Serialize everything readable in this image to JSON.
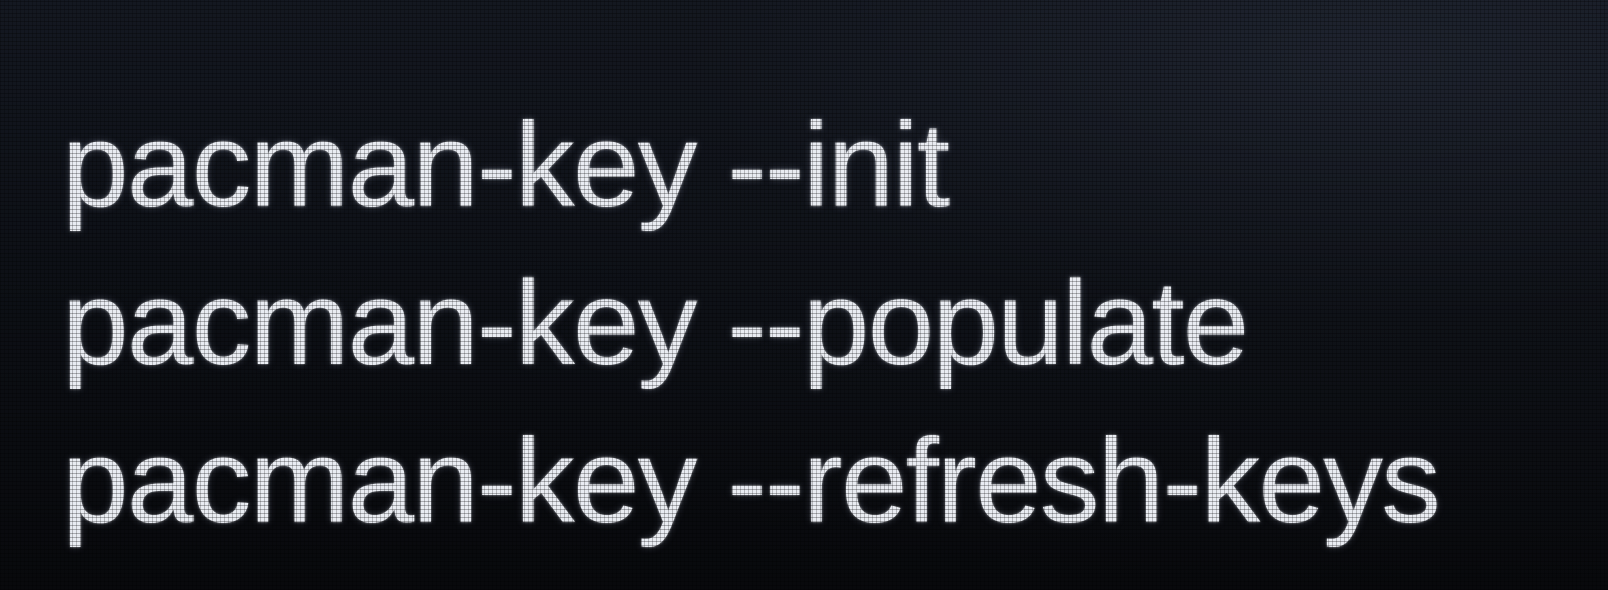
{
  "terminal": {
    "lines": [
      "pacman-key --init",
      "pacman-key --populate",
      "pacman-key --refresh-keys"
    ]
  }
}
